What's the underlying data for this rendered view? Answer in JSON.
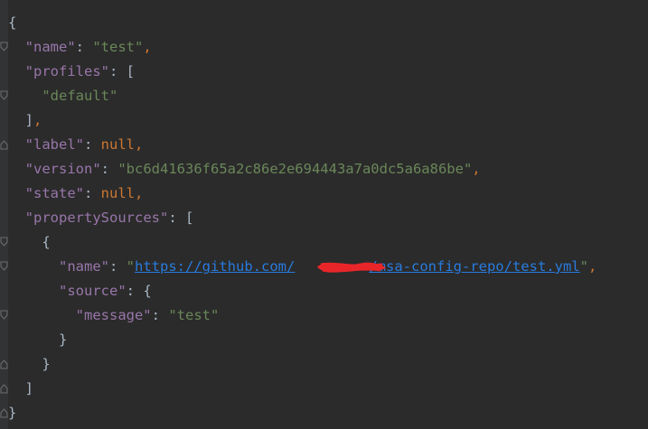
{
  "code": {
    "open_brace": "{",
    "name_key": "\"name\"",
    "name_value": "\"test\"",
    "profiles_key": "\"profiles\"",
    "default_value": "\"default\"",
    "label_key": "\"label\"",
    "null_kw": "null",
    "version_key": "\"version\"",
    "version_value": "\"bc6d41636f65a2c86e2e694443a7a0dc5a6a86be\"",
    "state_key": "\"state\"",
    "property_sources_key": "\"propertySources\"",
    "ps_name_key": "\"name\"",
    "url_prefix": "https://github.com/",
    "url_suffix": "/msa-config-repo/test.yml",
    "source_key": "\"source\"",
    "message_key": "\"message\"",
    "message_value": "\"test\"",
    "close_brace": "}"
  },
  "colors": {
    "background": "#2b2b2b",
    "key": "#9876aa",
    "string": "#6a8759",
    "keyword": "#cc7832",
    "url": "#287bde",
    "redaction": "#e8262a"
  }
}
